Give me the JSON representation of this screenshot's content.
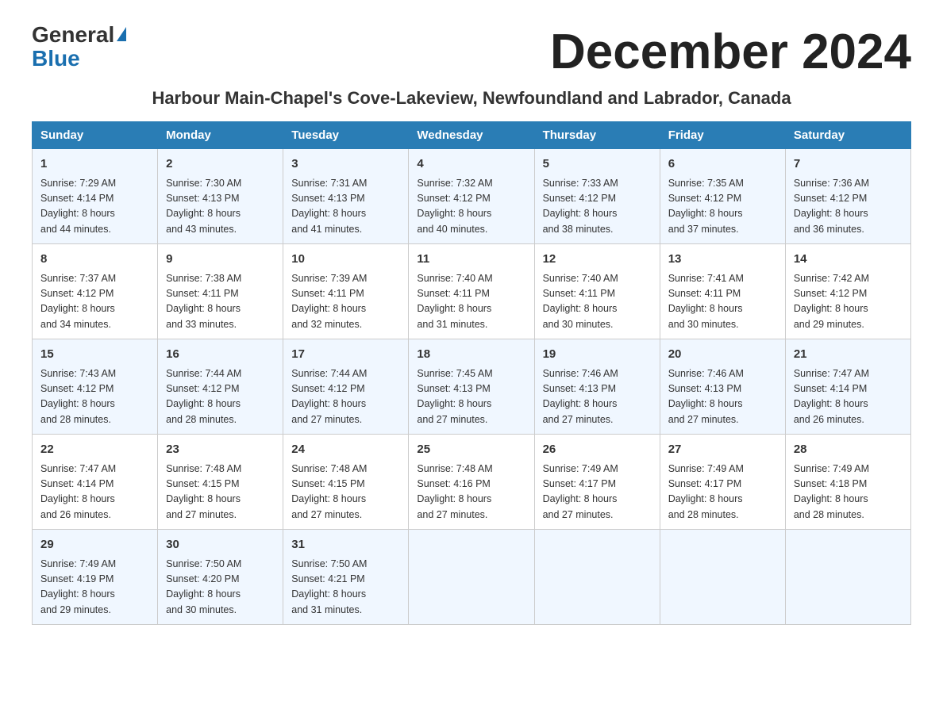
{
  "header": {
    "logo_general": "General",
    "logo_blue": "Blue",
    "month_title": "December 2024",
    "location": "Harbour Main-Chapel's Cove-Lakeview, Newfoundland and Labrador, Canada"
  },
  "days_of_week": [
    "Sunday",
    "Monday",
    "Tuesday",
    "Wednesday",
    "Thursday",
    "Friday",
    "Saturday"
  ],
  "weeks": [
    [
      {
        "day": "1",
        "sunrise": "7:29 AM",
        "sunset": "4:14 PM",
        "daylight": "8 hours and 44 minutes."
      },
      {
        "day": "2",
        "sunrise": "7:30 AM",
        "sunset": "4:13 PM",
        "daylight": "8 hours and 43 minutes."
      },
      {
        "day": "3",
        "sunrise": "7:31 AM",
        "sunset": "4:13 PM",
        "daylight": "8 hours and 41 minutes."
      },
      {
        "day": "4",
        "sunrise": "7:32 AM",
        "sunset": "4:12 PM",
        "daylight": "8 hours and 40 minutes."
      },
      {
        "day": "5",
        "sunrise": "7:33 AM",
        "sunset": "4:12 PM",
        "daylight": "8 hours and 38 minutes."
      },
      {
        "day": "6",
        "sunrise": "7:35 AM",
        "sunset": "4:12 PM",
        "daylight": "8 hours and 37 minutes."
      },
      {
        "day": "7",
        "sunrise": "7:36 AM",
        "sunset": "4:12 PM",
        "daylight": "8 hours and 36 minutes."
      }
    ],
    [
      {
        "day": "8",
        "sunrise": "7:37 AM",
        "sunset": "4:12 PM",
        "daylight": "8 hours and 34 minutes."
      },
      {
        "day": "9",
        "sunrise": "7:38 AM",
        "sunset": "4:11 PM",
        "daylight": "8 hours and 33 minutes."
      },
      {
        "day": "10",
        "sunrise": "7:39 AM",
        "sunset": "4:11 PM",
        "daylight": "8 hours and 32 minutes."
      },
      {
        "day": "11",
        "sunrise": "7:40 AM",
        "sunset": "4:11 PM",
        "daylight": "8 hours and 31 minutes."
      },
      {
        "day": "12",
        "sunrise": "7:40 AM",
        "sunset": "4:11 PM",
        "daylight": "8 hours and 30 minutes."
      },
      {
        "day": "13",
        "sunrise": "7:41 AM",
        "sunset": "4:11 PM",
        "daylight": "8 hours and 30 minutes."
      },
      {
        "day": "14",
        "sunrise": "7:42 AM",
        "sunset": "4:12 PM",
        "daylight": "8 hours and 29 minutes."
      }
    ],
    [
      {
        "day": "15",
        "sunrise": "7:43 AM",
        "sunset": "4:12 PM",
        "daylight": "8 hours and 28 minutes."
      },
      {
        "day": "16",
        "sunrise": "7:44 AM",
        "sunset": "4:12 PM",
        "daylight": "8 hours and 28 minutes."
      },
      {
        "day": "17",
        "sunrise": "7:44 AM",
        "sunset": "4:12 PM",
        "daylight": "8 hours and 27 minutes."
      },
      {
        "day": "18",
        "sunrise": "7:45 AM",
        "sunset": "4:13 PM",
        "daylight": "8 hours and 27 minutes."
      },
      {
        "day": "19",
        "sunrise": "7:46 AM",
        "sunset": "4:13 PM",
        "daylight": "8 hours and 27 minutes."
      },
      {
        "day": "20",
        "sunrise": "7:46 AM",
        "sunset": "4:13 PM",
        "daylight": "8 hours and 27 minutes."
      },
      {
        "day": "21",
        "sunrise": "7:47 AM",
        "sunset": "4:14 PM",
        "daylight": "8 hours and 26 minutes."
      }
    ],
    [
      {
        "day": "22",
        "sunrise": "7:47 AM",
        "sunset": "4:14 PM",
        "daylight": "8 hours and 26 minutes."
      },
      {
        "day": "23",
        "sunrise": "7:48 AM",
        "sunset": "4:15 PM",
        "daylight": "8 hours and 27 minutes."
      },
      {
        "day": "24",
        "sunrise": "7:48 AM",
        "sunset": "4:15 PM",
        "daylight": "8 hours and 27 minutes."
      },
      {
        "day": "25",
        "sunrise": "7:48 AM",
        "sunset": "4:16 PM",
        "daylight": "8 hours and 27 minutes."
      },
      {
        "day": "26",
        "sunrise": "7:49 AM",
        "sunset": "4:17 PM",
        "daylight": "8 hours and 27 minutes."
      },
      {
        "day": "27",
        "sunrise": "7:49 AM",
        "sunset": "4:17 PM",
        "daylight": "8 hours and 28 minutes."
      },
      {
        "day": "28",
        "sunrise": "7:49 AM",
        "sunset": "4:18 PM",
        "daylight": "8 hours and 28 minutes."
      }
    ],
    [
      {
        "day": "29",
        "sunrise": "7:49 AM",
        "sunset": "4:19 PM",
        "daylight": "8 hours and 29 minutes."
      },
      {
        "day": "30",
        "sunrise": "7:50 AM",
        "sunset": "4:20 PM",
        "daylight": "8 hours and 30 minutes."
      },
      {
        "day": "31",
        "sunrise": "7:50 AM",
        "sunset": "4:21 PM",
        "daylight": "8 hours and 31 minutes."
      },
      null,
      null,
      null,
      null
    ]
  ],
  "labels": {
    "sunrise": "Sunrise:",
    "sunset": "Sunset:",
    "daylight": "Daylight:"
  }
}
